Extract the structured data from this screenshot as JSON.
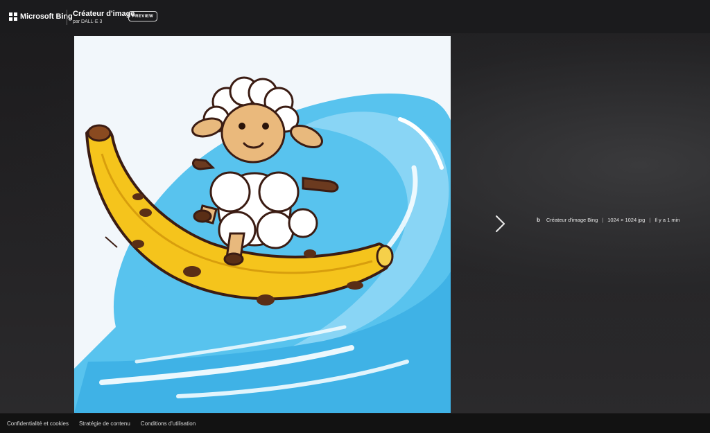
{
  "header": {
    "brand": "Microsoft Bing",
    "title": "Créateur d'image",
    "subtitle": "par DALL·E 3",
    "preview_label": "PREVIEW"
  },
  "image": {
    "alt": "Illustration d'un mouton surfant sur une banane dans une vague"
  },
  "meta": {
    "bing_glyph": "b",
    "source": "Créateur d'image Bing",
    "separator": "|",
    "size": "1024 × 1024 jpg",
    "time": "Il y a 1 min"
  },
  "footer": {
    "links": [
      "Confidentialité et cookies",
      "Stratégie de contenu",
      "Conditions d'utilisation"
    ]
  },
  "colors": {
    "header_bg": "#1b1b1d",
    "footer_bg": "#121212",
    "banana": "#f5c41c",
    "wave": "#4fbfe9"
  },
  "icons": {
    "next": "chevron-right-icon",
    "logo": "microsoft-logo-icon"
  }
}
